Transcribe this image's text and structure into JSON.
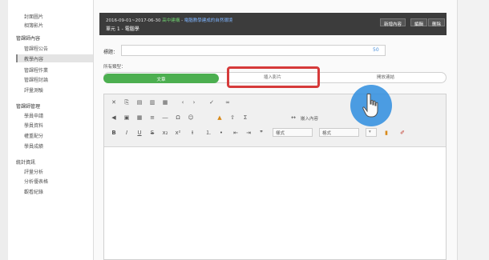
{
  "sidebar": {
    "items": [
      {
        "label": "封面圖片",
        "type": "sub"
      },
      {
        "label": "相簿影片",
        "type": "sub"
      },
      {
        "label": "管課師內容",
        "type": "group"
      },
      {
        "label": "管課程公告",
        "type": "sub"
      },
      {
        "label": "教學內容",
        "type": "active"
      },
      {
        "label": "管課程作業",
        "type": "sub"
      },
      {
        "label": "管課程討論",
        "type": "sub"
      },
      {
        "label": "評量測驗",
        "type": "sub"
      },
      {
        "label": "管課師管理",
        "type": "group"
      },
      {
        "label": "學員申請",
        "type": "sub"
      },
      {
        "label": "學員資料",
        "type": "sub"
      },
      {
        "label": "權重配分",
        "type": "sub"
      },
      {
        "label": "學員成績",
        "type": "sub"
      },
      {
        "label": "統計資訊",
        "type": "group"
      },
      {
        "label": "評量分析",
        "type": "sub"
      },
      {
        "label": "分析優表格",
        "type": "sub"
      },
      {
        "label": "觀看紀錄",
        "type": "sub"
      }
    ]
  },
  "header": {
    "date_range": "2016-09-01~2017-06-30",
    "grade": "高中建構",
    "course": "電腦教學建成的自然環境",
    "unit": "單元 1 - 電腦學",
    "buttons": [
      "新增內容",
      "編輯",
      "刪除"
    ]
  },
  "form": {
    "title_label": "標題：",
    "title_value": "",
    "title_count": "50",
    "type_label": "所有類型：",
    "types": [
      {
        "label": "文章",
        "active": true
      },
      {
        "label": "插入影片",
        "active": false
      },
      {
        "label": "開放連結",
        "active": false
      }
    ]
  },
  "editor": {
    "row3_selects": [
      "樣式",
      "格式",
      "字體"
    ],
    "add_embed": "嵌入內容"
  }
}
